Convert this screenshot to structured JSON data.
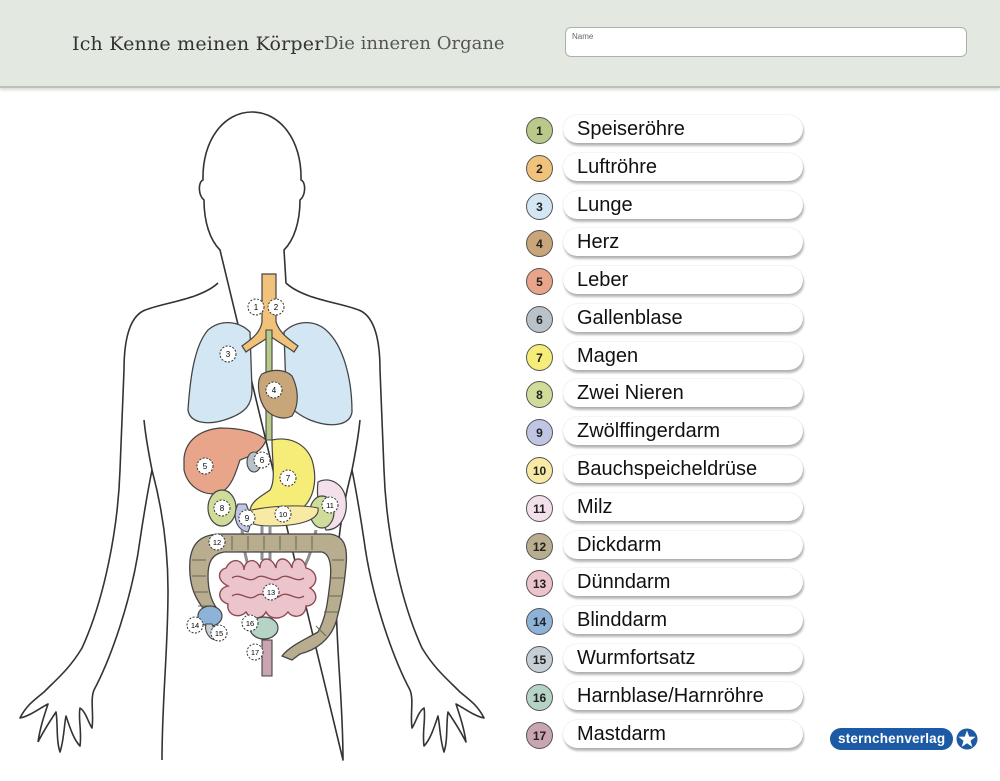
{
  "header": {
    "title": "Ich Kenne meinen Körper",
    "subtitle": "Die inneren Organe",
    "name_label": "Name",
    "name_value": ""
  },
  "figure": {
    "markers": [
      "1",
      "2",
      "3",
      "4",
      "5",
      "6",
      "7",
      "8",
      "9",
      "10",
      "11",
      "12",
      "13",
      "14",
      "15",
      "16",
      "17"
    ]
  },
  "legend": {
    "items": [
      {
        "number": "1",
        "label": "Speiseröhre",
        "color": "#b9c98a"
      },
      {
        "number": "2",
        "label": "Luftröhre",
        "color": "#f0c27a"
      },
      {
        "number": "3",
        "label": "Lunge",
        "color": "#d2e6f3"
      },
      {
        "number": "4",
        "label": "Herz",
        "color": "#c9a57a"
      },
      {
        "number": "5",
        "label": "Leber",
        "color": "#e9a58a"
      },
      {
        "number": "6",
        "label": "Gallenblase",
        "color": "#b9c2c9"
      },
      {
        "number": "7",
        "label": "Magen",
        "color": "#f6ec78"
      },
      {
        "number": "8",
        "label": "Zwei Nieren",
        "color": "#cfdc9a"
      },
      {
        "number": "9",
        "label": "Zwölffingerdarm",
        "color": "#bfc5e3"
      },
      {
        "number": "10",
        "label": "Bauchspeicheldrüse",
        "color": "#f8eaa5"
      },
      {
        "number": "11",
        "label": "Milz",
        "color": "#f3e0ea"
      },
      {
        "number": "12",
        "label": "Dickdarm",
        "color": "#b8ad8e"
      },
      {
        "number": "13",
        "label": "Dünndarm",
        "color": "#ecc4cb"
      },
      {
        "number": "14",
        "label": "Blinddarm",
        "color": "#8db3d8"
      },
      {
        "number": "15",
        "label": "Wurmfortsatz",
        "color": "#c6cfd6"
      },
      {
        "number": "16",
        "label": "Harnblase/Harnröhre",
        "color": "#b6d4c6"
      },
      {
        "number": "17",
        "label": "Mastdarm",
        "color": "#c9a5b1"
      }
    ]
  },
  "logo": {
    "text": "sternchenverlag",
    "brand_color": "#1c5aa5",
    "icon": "star-icon"
  }
}
